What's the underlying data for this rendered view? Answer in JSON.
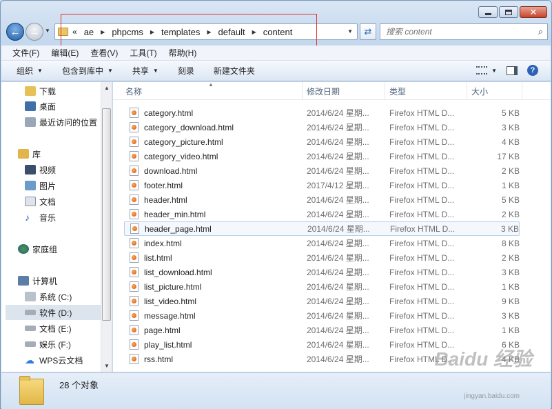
{
  "breadcrumb": {
    "overflow": "«",
    "parts": [
      "ae",
      "phpcms",
      "templates",
      "default",
      "content"
    ]
  },
  "search": {
    "placeholder": "搜索 content"
  },
  "menu": [
    "文件(F)",
    "编辑(E)",
    "查看(V)",
    "工具(T)",
    "帮助(H)"
  ],
  "toolbar": {
    "organize": "组织",
    "include_library": "包含到库中",
    "share": "共享",
    "burn": "刻录",
    "new_folder": "新建文件夹"
  },
  "nav": {
    "downloads": "下载",
    "desktop": "桌面",
    "recent": "最近访问的位置",
    "libraries": "库",
    "videos": "视频",
    "pictures": "图片",
    "documents": "文档",
    "music": "音乐",
    "homegroup": "家庭组",
    "computer": "计算机",
    "drive_c": "系统 (C:)",
    "drive_d": "软件 (D:)",
    "drive_e": "文档 (E:)",
    "drive_f": "娱乐 (F:)",
    "wps": "WPS云文档"
  },
  "columns": {
    "name": "名称",
    "date": "修改日期",
    "type": "类型",
    "size": "大小"
  },
  "files": [
    {
      "name": "category.html",
      "date": "2014/6/24 星期...",
      "type": "Firefox HTML D...",
      "size": "5 KB"
    },
    {
      "name": "category_download.html",
      "date": "2014/6/24 星期...",
      "type": "Firefox HTML D...",
      "size": "3 KB"
    },
    {
      "name": "category_picture.html",
      "date": "2014/6/24 星期...",
      "type": "Firefox HTML D...",
      "size": "4 KB"
    },
    {
      "name": "category_video.html",
      "date": "2014/6/24 星期...",
      "type": "Firefox HTML D...",
      "size": "17 KB"
    },
    {
      "name": "download.html",
      "date": "2014/6/24 星期...",
      "type": "Firefox HTML D...",
      "size": "2 KB"
    },
    {
      "name": "footer.html",
      "date": "2017/4/12 星期...",
      "type": "Firefox HTML D...",
      "size": "1 KB"
    },
    {
      "name": "header.html",
      "date": "2014/6/24 星期...",
      "type": "Firefox HTML D...",
      "size": "5 KB"
    },
    {
      "name": "header_min.html",
      "date": "2014/6/24 星期...",
      "type": "Firefox HTML D...",
      "size": "2 KB"
    },
    {
      "name": "header_page.html",
      "date": "2014/6/24 星期...",
      "type": "Firefox HTML D...",
      "size": "3 KB"
    },
    {
      "name": "index.html",
      "date": "2014/6/24 星期...",
      "type": "Firefox HTML D...",
      "size": "8 KB"
    },
    {
      "name": "list.html",
      "date": "2014/6/24 星期...",
      "type": "Firefox HTML D...",
      "size": "2 KB"
    },
    {
      "name": "list_download.html",
      "date": "2014/6/24 星期...",
      "type": "Firefox HTML D...",
      "size": "3 KB"
    },
    {
      "name": "list_picture.html",
      "date": "2014/6/24 星期...",
      "type": "Firefox HTML D...",
      "size": "1 KB"
    },
    {
      "name": "list_video.html",
      "date": "2014/6/24 星期...",
      "type": "Firefox HTML D...",
      "size": "9 KB"
    },
    {
      "name": "message.html",
      "date": "2014/6/24 星期...",
      "type": "Firefox HTML D...",
      "size": "3 KB"
    },
    {
      "name": "page.html",
      "date": "2014/6/24 星期...",
      "type": "Firefox HTML D...",
      "size": "1 KB"
    },
    {
      "name": "play_list.html",
      "date": "2014/6/24 星期...",
      "type": "Firefox HTML D...",
      "size": "6 KB"
    },
    {
      "name": "rss.html",
      "date": "2014/6/24 星期...",
      "type": "Firefox HTML D...",
      "size": "4 KB"
    }
  ],
  "status": {
    "count": "28 个对象"
  },
  "watermark": {
    "logo": "Baidu 经验",
    "url": "jingyan.baidu.com"
  },
  "icons": {
    "back": "back-arrow-icon",
    "forward": "forward-arrow-icon",
    "refresh": "refresh-icon",
    "search": "magnifier-icon",
    "help": "help-icon",
    "file": "firefox-html-file-icon",
    "folder": "folder-icon"
  },
  "colors": {
    "highlight_border": "#d9322e",
    "accent": "#2c63b8"
  }
}
